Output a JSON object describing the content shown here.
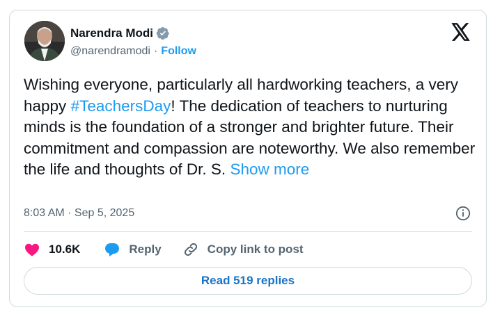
{
  "author": {
    "name": "Narendra Modi",
    "handle": "@narendramodi",
    "separator": "·",
    "follow_label": "Follow"
  },
  "tweet": {
    "text_before": "Wishing everyone, particularly all hardworking teachers, a very happy ",
    "hashtag": "#TeachersDay",
    "text_after": "! The dedication of teachers to nurturing minds is the foundation of a stronger and brighter future. Their commitment and compassion are noteworthy. We also remember the life and thoughts of Dr. S. ",
    "show_more": "Show more",
    "timestamp": "8:03 AM · Sep 5, 2025"
  },
  "actions": {
    "likes": "10.6K",
    "reply_label": "Reply",
    "copy_label": "Copy link to post"
  },
  "read_replies": "Read 519 replies",
  "colors": {
    "accent": "#1d9bf0",
    "like": "#f91880",
    "text": "#0f1419",
    "muted": "#536471",
    "border": "#cfd9de"
  },
  "icons": [
    "verified-badge-icon",
    "x-logo-icon",
    "info-icon",
    "heart-icon",
    "reply-bubble-icon",
    "link-icon"
  ]
}
